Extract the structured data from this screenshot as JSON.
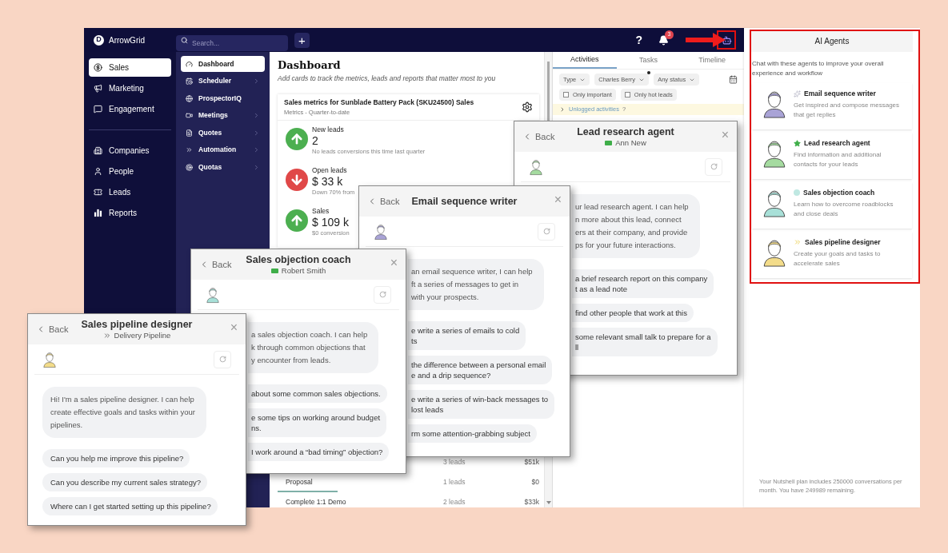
{
  "app": {
    "logo": {
      "letter": "D",
      "name": "ArrowGrid"
    },
    "search": {
      "placeholder": "Search..."
    },
    "add_button": "+",
    "help": "?",
    "notifications_badge": "3",
    "sidebar": {
      "groups": [
        [
          {
            "label": "Sales",
            "selected": true
          },
          {
            "label": "Marketing",
            "selected": false
          },
          {
            "label": "Engagement",
            "selected": false
          }
        ],
        [
          {
            "label": "Companies",
            "selected": false
          },
          {
            "label": "People",
            "selected": false
          },
          {
            "label": "Leads",
            "selected": false
          },
          {
            "label": "Reports",
            "selected": false
          }
        ]
      ]
    },
    "subnav": [
      {
        "label": "Dashboard",
        "selected": true,
        "expandable": false
      },
      {
        "label": "Scheduler",
        "selected": false,
        "expandable": true
      },
      {
        "label": "ProspectorIQ",
        "selected": false,
        "expandable": false
      },
      {
        "label": "Meetings",
        "selected": false,
        "expandable": true
      },
      {
        "label": "Quotes",
        "selected": false,
        "expandable": true
      },
      {
        "label": "Automation",
        "selected": false,
        "expandable": true
      },
      {
        "label": "Quotas",
        "selected": false,
        "expandable": true
      }
    ],
    "dashboard": {
      "title": "Dashboard",
      "subtitle": "Add cards to track the metrics, leads and reports that matter most to you",
      "card": {
        "title": "Sales metrics for Sunblade Battery Pack (SKU24500) Sales",
        "subtitle": "Metrics - Quarter-to-date",
        "metrics": [
          {
            "label": "New leads",
            "value": "2",
            "note": "No leads conversions this time last quarter",
            "rising": true
          },
          {
            "label": "Open leads",
            "value": "$ 33 k",
            "note": "Down 70% from",
            "rising": false
          },
          {
            "label": "Sales",
            "value": "$ 109 k",
            "note": "$0 conversion",
            "rising": true
          }
        ]
      },
      "rows": [
        {
          "leads": "3 leads",
          "amount": "$51k"
        },
        {
          "stage": "Proposal",
          "leads": "1 leads",
          "amount": "$0",
          "active": true
        },
        {
          "stage": "Complete 1:1 Demo",
          "leads": "2 leads",
          "amount": "$33k",
          "active": false
        }
      ]
    },
    "activities": {
      "tabs": [
        {
          "label": "Activities",
          "selected": true
        },
        {
          "label": "Tasks",
          "selected": false
        },
        {
          "label": "Timeline",
          "selected": false
        }
      ],
      "filters": [
        {
          "label": "Type",
          "dot": false
        },
        {
          "label": "Charles Berry",
          "dot": true
        },
        {
          "label": "Any status",
          "dot": false
        }
      ],
      "checkboxes": [
        {
          "label": "Only important",
          "checked": false
        },
        {
          "label": "Only hot leads",
          "checked": false
        }
      ],
      "unlogged": {
        "label": "Unlogged activities",
        "help": "?"
      }
    }
  },
  "ai_panel": {
    "title": "AI Agents",
    "description": "Chat with these agents to improve your overall experience and workflow",
    "agents": [
      {
        "name": "Email sequence writer",
        "description": "Get inspired and compose messages that get replies",
        "kind": "sparkle",
        "color": "#a9a3d6"
      },
      {
        "name": "Lead research agent",
        "description": "Find information and additional contacts for your leads",
        "kind": "star",
        "color": "#a5dba0"
      },
      {
        "name": "Sales objection coach",
        "description": "Learn how to overcome roadblocks and close deals",
        "kind": "dot",
        "color": "#a8e0d8"
      },
      {
        "name": "Sales pipeline designer",
        "description": "Create your goals and tasks to accelerate sales",
        "kind": "chevrons",
        "color": "#f3dc8a"
      }
    ],
    "footer": "Your Nutshell plan includes 250000 conversations per month. You have 249989 remaining."
  },
  "dialogs": [
    {
      "title": "Lead research agent",
      "subtitle": {
        "text": "Ann New",
        "kind": "tag"
      },
      "back": "Back",
      "close": "×",
      "color": "#a5dba0",
      "intro": [
        "ur lead research agent. I can help",
        "n more about this lead, connect",
        "ers at their company, and provide",
        "ps for your future interactions."
      ],
      "suggestions": [
        [
          "a brief research report on this company",
          "t as a lead note"
        ],
        [
          "find other people that work at this"
        ],
        [
          "some relevant small talk to prepare for a",
          "ll"
        ]
      ]
    },
    {
      "title": "Email sequence writer",
      "back": "Back",
      "close": "×",
      "color": "#a9a3d6",
      "intro": [
        "an email sequence writer, I can help",
        "ft a series of messages to get in",
        "with your prospects."
      ],
      "suggestions": [
        [
          "e write a series of emails to cold",
          "ts"
        ],
        [
          "the difference between a personal email",
          "e and a drip sequence?"
        ],
        [
          "e write a series of win-back messages to",
          "lost leads"
        ],
        [
          "rm some attention-grabbing subject"
        ]
      ]
    },
    {
      "title": "Sales objection coach",
      "subtitle": {
        "text": "Robert Smith",
        "kind": "tag"
      },
      "back": "Back",
      "close": "×",
      "color": "#a8e0d8",
      "intro": [
        "a sales objection coach. I can help",
        "k through common objections that",
        "y encounter from leads."
      ],
      "suggestions": [
        [
          "about some common sales objections."
        ],
        [
          "e some tips on working around budget",
          "ns."
        ],
        [
          "I work around a “bad timing” objection?"
        ]
      ]
    },
    {
      "title": "Sales pipeline designer",
      "subtitle": {
        "text": "Delivery Pipeline",
        "kind": "chevrons"
      },
      "back": "Back",
      "close": "×",
      "color": "#f3dc8a",
      "intro": [
        "Hi! I'm a sales pipeline designer. I can help",
        "create effective goals and tasks within your",
        "pipelines."
      ],
      "suggestions": [
        [
          "Can you help me improve this pipeline?"
        ],
        [
          "Can you describe my current sales strategy?"
        ],
        [
          "Where can I get started setting up this pipeline?"
        ]
      ]
    }
  ]
}
